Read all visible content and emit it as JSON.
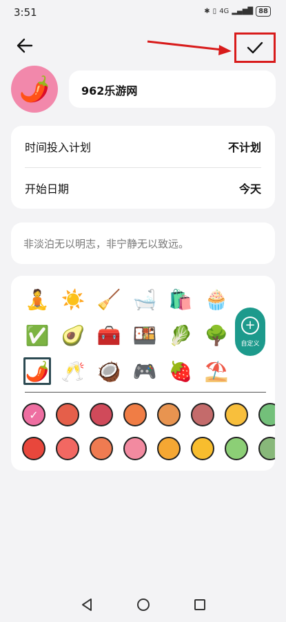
{
  "status": {
    "time": "3:51",
    "battery": "88",
    "signal": "4G"
  },
  "header": {
    "back_icon": "arrow-left-icon",
    "confirm_icon": "check-icon"
  },
  "project": {
    "name": "962乐游网",
    "avatar_emoji": "🌶️",
    "avatar_bg": "#f288ab"
  },
  "settings": {
    "rows": [
      {
        "label": "时间投入计划",
        "value": "不计划"
      },
      {
        "label": "开始日期",
        "value": "今天"
      }
    ]
  },
  "motto": "非淡泊无以明志，非宁静无以致远。",
  "icon_picker": {
    "icons": [
      "🧘",
      "☀️",
      "🧹",
      "🛁",
      "🛍️",
      "🧁",
      "✅",
      "🥑",
      "🧰",
      "🍱",
      "🥬",
      "🌳",
      "🌶️",
      "🥂",
      "🥥",
      "🎮",
      "🍓",
      "⛱️"
    ],
    "selected_index": 12,
    "custom_label": "自定义",
    "custom_plus": "+"
  },
  "colors": {
    "row1": [
      "#ee6ea1",
      "#e55f4a",
      "#d04a5a",
      "#f07d45",
      "#e89450",
      "#c46b6b",
      "#f8bf3c",
      "#73c07a"
    ],
    "row2": [
      "#e8473c",
      "#f26862",
      "#ef7b51",
      "#f28aa0",
      "#f5a733",
      "#f8bd2e",
      "#8ccf76",
      "#88b87a"
    ],
    "selected_mark": "✓"
  },
  "nav": {
    "back": "triangle-back-icon",
    "home": "circle-home-icon",
    "recents": "square-recents-icon"
  }
}
